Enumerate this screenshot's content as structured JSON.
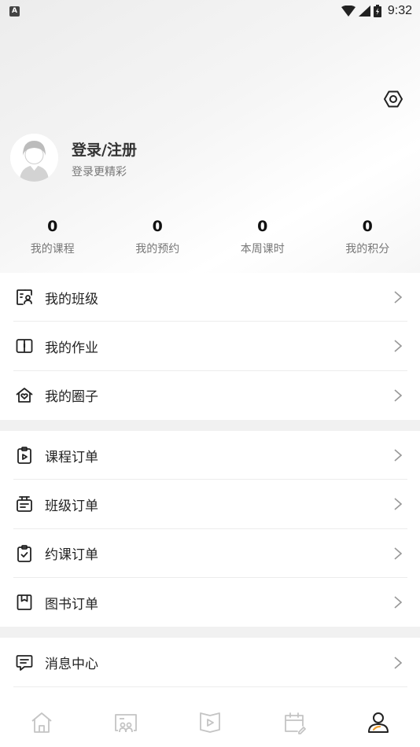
{
  "status_bar": {
    "app_badge": "A",
    "time": "9:32",
    "icons": [
      "wifi-icon",
      "signal-icon",
      "battery-icon"
    ]
  },
  "profile": {
    "login_title": "登录/注册",
    "login_subtitle": "登录更精彩"
  },
  "stats": [
    {
      "value": "0",
      "label": "我的课程"
    },
    {
      "value": "0",
      "label": "我的预约"
    },
    {
      "value": "0",
      "label": "本周课时"
    },
    {
      "value": "0",
      "label": "我的积分"
    }
  ],
  "menu": {
    "group1": [
      {
        "label": "我的班级",
        "icon": "class-icon"
      },
      {
        "label": "我的作业",
        "icon": "homework-book-icon"
      },
      {
        "label": "我的圈子",
        "icon": "circle-home-icon"
      }
    ],
    "group2": [
      {
        "label": "课程订单",
        "icon": "course-order-icon"
      },
      {
        "label": "班级订单",
        "icon": "class-order-icon"
      },
      {
        "label": "约课订单",
        "icon": "booking-order-icon"
      },
      {
        "label": "图书订单",
        "icon": "book-order-icon"
      }
    ],
    "group3": [
      {
        "label": "消息中心",
        "icon": "message-icon"
      }
    ]
  },
  "tabbar": {
    "tabs": [
      "home-icon",
      "class-tab-icon",
      "video-tab-icon",
      "calendar-tab-icon",
      "profile-tab-icon"
    ],
    "active_index": 4,
    "active_color": "#222222",
    "accent_color": "#f0a030",
    "inactive_color": "#c4c4c4"
  }
}
